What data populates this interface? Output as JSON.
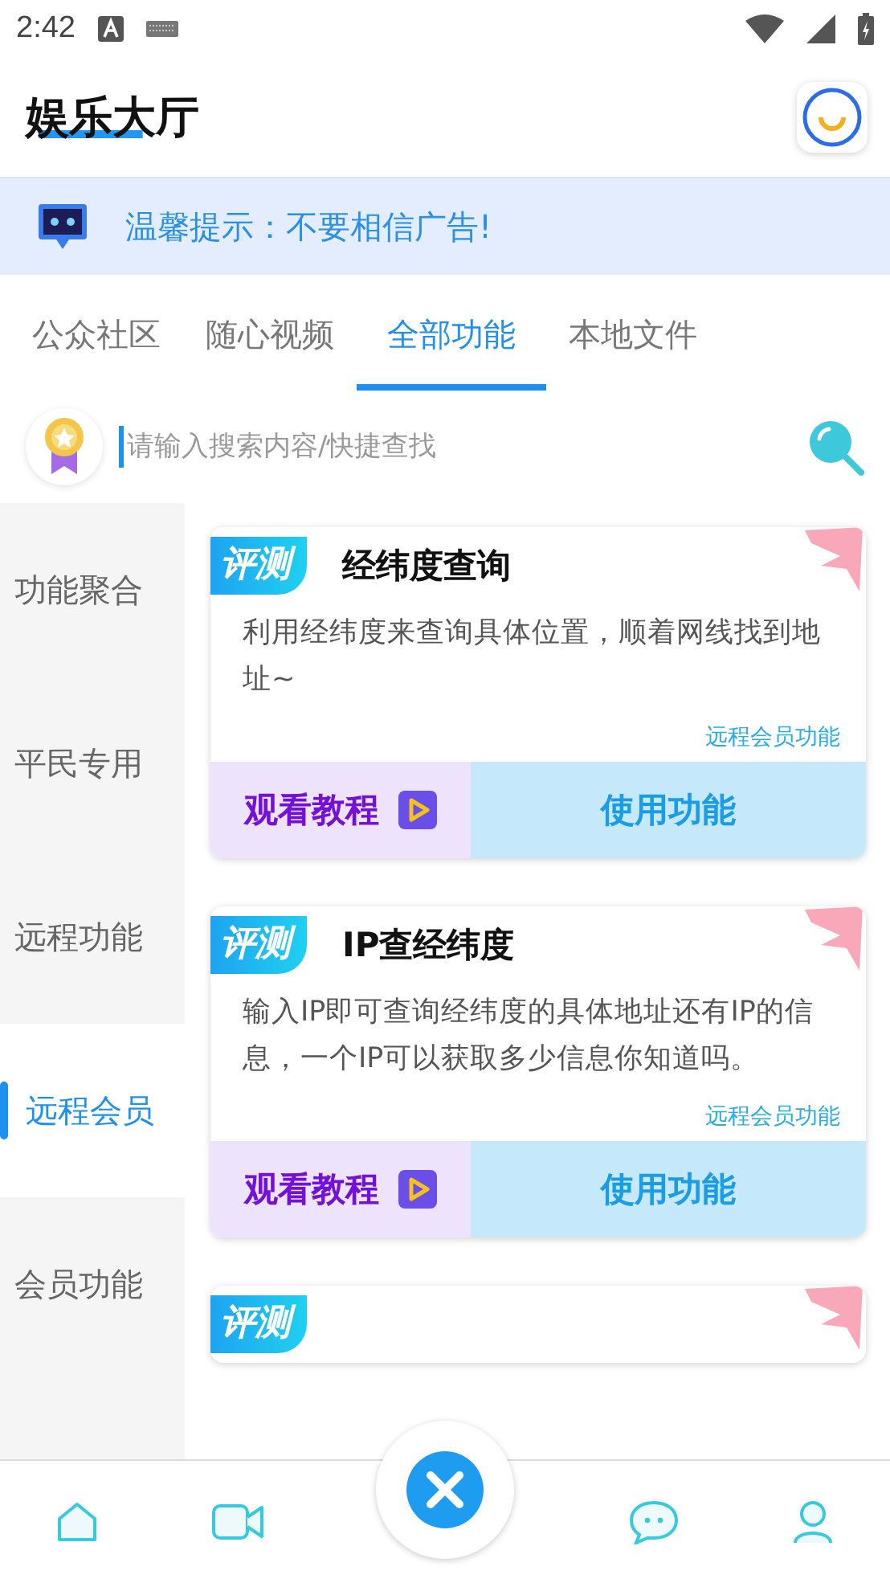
{
  "status_bar": {
    "time": "2:42"
  },
  "header": {
    "title": "娱乐大厅"
  },
  "notice": {
    "text": "温馨提示：不要相信广告!"
  },
  "tabs": [
    {
      "label": "公众社区",
      "selected": false
    },
    {
      "label": "随心视频",
      "selected": false
    },
    {
      "label": "全部功能",
      "selected": true
    },
    {
      "label": "本地文件",
      "selected": false
    }
  ],
  "search": {
    "placeholder": "请输入搜索内容/快捷查找"
  },
  "sidebar": {
    "items": [
      {
        "label": "功能聚合",
        "selected": false
      },
      {
        "label": "平民专用",
        "selected": false
      },
      {
        "label": "远程功能",
        "selected": false
      },
      {
        "label": "远程会员",
        "selected": true
      },
      {
        "label": "会员功能",
        "selected": false
      }
    ]
  },
  "cards": [
    {
      "badge": "评测",
      "title": "经纬度查询",
      "description": "利用经纬度来查询具体位置，顺着网线找到地址~",
      "tag": "远程会员功能",
      "tutorial_button": "观看教程",
      "use_button": "使用功能"
    },
    {
      "badge": "评测",
      "title": "IP查经纬度",
      "description": "输入IP即可查询经纬度的具体地址还有IP的信息，一个IP可以获取多少信息你知道吗。",
      "tag": "远程会员功能",
      "tutorial_button": "观看教程",
      "use_button": "使用功能"
    },
    {
      "badge": "评测"
    }
  ]
}
